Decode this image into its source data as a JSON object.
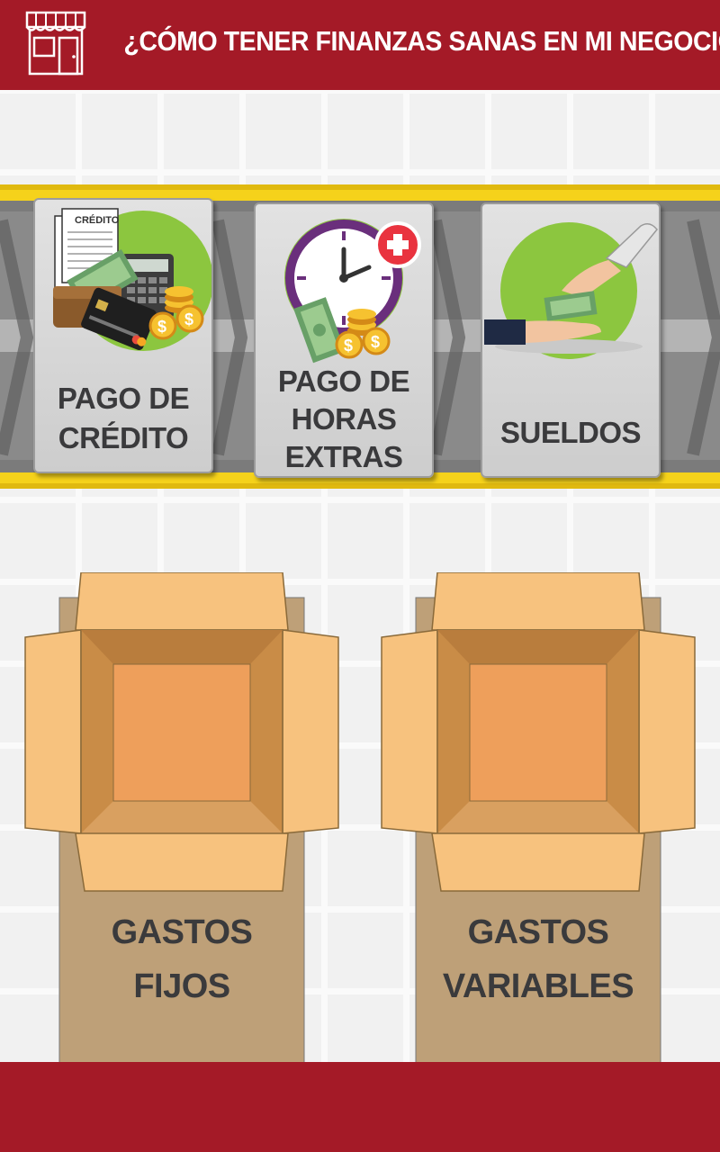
{
  "header": {
    "title": "¿CÓMO TENER FINANZAS SANAS EN MI NEGOCIO?",
    "icon": "store-icon"
  },
  "cards": [
    {
      "line1": "PAGO DE",
      "line2": "CRÉDITO",
      "art_text": "CRÉDITO",
      "icon": "credit-payment-icon"
    },
    {
      "line1": "PAGO DE",
      "line2": "HORAS",
      "line3": "EXTRAS",
      "icon": "overtime-clock-icon"
    },
    {
      "line1": "SUELDOS",
      "icon": "salary-hand-icon"
    }
  ],
  "boxes": [
    {
      "line1": "GASTOS",
      "line2": "FIJOS"
    },
    {
      "line1": "GASTOS",
      "line2": "VARIABLES"
    }
  ],
  "colors": {
    "brand_red": "#a41a27",
    "belt_yellow": "#f5d21b",
    "belt_gray": "#7a7a7a",
    "box_tan": "#f7c27e",
    "box_inner": "#ee9f5b",
    "text_dark": "#3a3a3c",
    "lime": "#8cc63f"
  }
}
